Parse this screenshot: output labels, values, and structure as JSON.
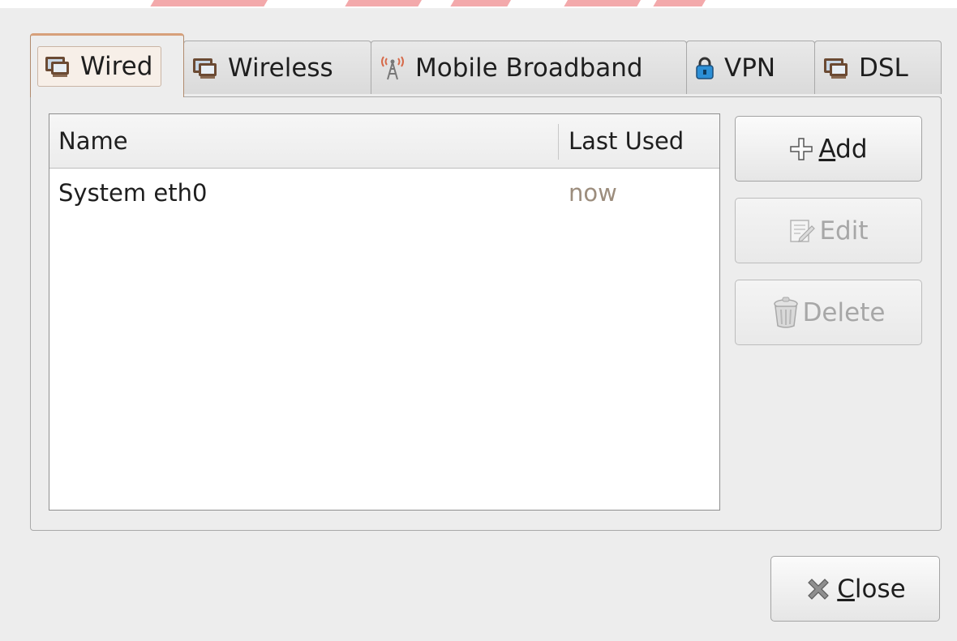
{
  "tabs": [
    {
      "label": "Wired",
      "icon": "network-wired-icon",
      "active": true
    },
    {
      "label": "Wireless",
      "icon": "network-wireless-icon",
      "active": false
    },
    {
      "label": "Mobile Broadband",
      "icon": "antenna-tower-icon",
      "active": false
    },
    {
      "label": "VPN",
      "icon": "padlock-icon",
      "active": false
    },
    {
      "label": "DSL",
      "icon": "network-dsl-icon",
      "active": false
    }
  ],
  "list": {
    "columns": [
      "Name",
      "Last Used"
    ],
    "rows": [
      {
        "name": "System eth0",
        "last_used": "now"
      }
    ]
  },
  "buttons": {
    "add": {
      "mnemonic": "A",
      "rest": "dd",
      "enabled": true
    },
    "edit": {
      "label": "Edit",
      "enabled": false
    },
    "delete": {
      "label": "Delete",
      "enabled": false
    },
    "close": {
      "mnemonic": "C",
      "rest": "lose",
      "enabled": true
    }
  },
  "colors": {
    "active_tab_accent": "#d7a07a",
    "last_used_text": "#9c8d7d",
    "watermark": "#f3a9ab"
  }
}
